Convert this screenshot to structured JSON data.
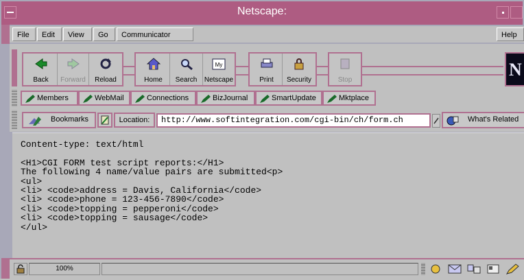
{
  "window": {
    "title": "Netscape:"
  },
  "menu": [
    "File",
    "Edit",
    "View",
    "Go",
    "Communicator"
  ],
  "help": "Help",
  "nav": {
    "back": "Back",
    "forward": "Forward",
    "reload": "Reload",
    "home": "Home",
    "search": "Search",
    "netscape": "Netscape",
    "print": "Print",
    "security": "Security",
    "stop": "Stop",
    "netscape_icon_text": "My",
    "logo_letter": "N"
  },
  "personal": [
    "Members",
    "WebMail",
    "Connections",
    "BizJournal",
    "SmartUpdate",
    "Mktplace"
  ],
  "location": {
    "bookmarks": "Bookmarks",
    "label": "Location:",
    "url": "http://www.softintegration.com/cgi-bin/ch/form.ch",
    "whats_related": "What's Related"
  },
  "content": {
    "lines": [
      "Content-type: text/html",
      "",
      "<H1>CGI FORM test script reports:</H1>",
      "The following 4 name/value pairs are submitted<p>",
      "<ul>",
      "<li> <code>address = Davis, California</code>",
      "<li> <code>phone = 123-456-7890</code>",
      "<li> <code>topping = pepperoni</code>",
      "<li> <code>topping = sausage</code>",
      "</ul>"
    ]
  },
  "status": {
    "progress": "100%"
  },
  "colors": {
    "accent": "#ae5c82"
  },
  "icons": [
    "sysmenu-icon",
    "back-arrow-icon",
    "forward-arrow-icon",
    "reload-icon",
    "home-icon",
    "search-icon",
    "netscape-icon",
    "print-icon",
    "security-lock-icon",
    "stop-icon",
    "bookmark-pen-icon",
    "bookmarks-icon",
    "location-page-icon",
    "whats-related-icon",
    "security-padlock-icon",
    "component-bar-icons"
  ]
}
